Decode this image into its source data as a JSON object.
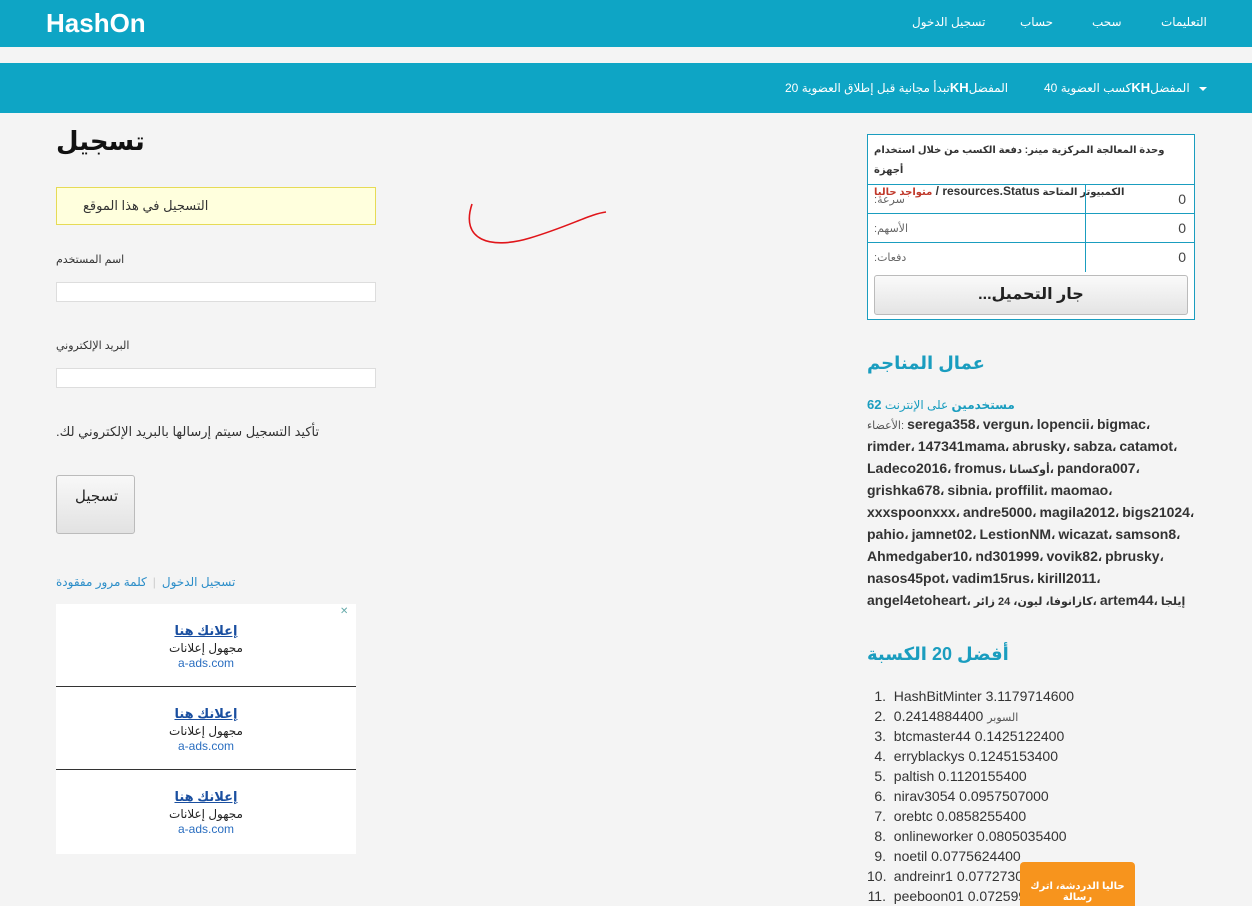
{
  "header": {
    "brand": "HashOn",
    "nav": [
      "التعليمات",
      "سحب",
      "حساب",
      "تسجيل الدخول"
    ]
  },
  "subnav": {
    "item1_prefix": "المفضل ",
    "item1_strong": "KH",
    "item1_suffix": "كسب العضوية 40",
    "item2_prefix": "المفضل ",
    "item2_strong": "KH",
    "item2_suffix": "تبدأ مجانية قبل إطلاق العضوية 20"
  },
  "register": {
    "title": "تسجيل",
    "notice": "التسجيل في هذا الموقع",
    "username_label": "اسم المستخدم",
    "email_label": "البريد الإلكتروني",
    "confirm_text": ".تأكيد التسجيل سيتم إرسالها بالبريد الإلكتروني لك",
    "button_label": "تسجيل",
    "login_link": "تسجيل الدخول",
    "lost_password_link": "كلمة مرور مفقودة"
  },
  "ads": [
    {
      "title": "إعلانك هنا",
      "subtitle": "مجهول إعلانات",
      "url": "a-ads.com"
    },
    {
      "title": "إعلانك هنا",
      "subtitle": "مجهول إعلانات",
      "url": "a-ads.com"
    },
    {
      "title": "إعلانك هنا",
      "subtitle": "مجهول إعلانات",
      "url": "a-ads.com"
    }
  ],
  "miner": {
    "head_line1": "وحدة المعالجة المركزية مينر: دفعة الكسب من خلال استخدام أجهزة",
    "head_line2_a": "الكمبيوتر المتاحة ",
    "head_line2_b": "resources.Status / ",
    "head_line2_status": "متواجد حاليا",
    "rows": [
      {
        "label": ":سرعة",
        "value": "0"
      },
      {
        "label": ":الأسهم",
        "value": "0"
      },
      {
        "label": ":دفعات",
        "value": "0"
      }
    ],
    "button": "...جار التحميل"
  },
  "workers": {
    "title": "عمال المناجم",
    "online_count": "62",
    "online_label": " على الإنترنت",
    "online_users_word": "مستخدمين",
    "members_prefix": "الأعضاء: ",
    "members": [
      "serega358",
      "vergun",
      "lopencii",
      "bigmac",
      "rimder",
      "147341mama",
      "abrusky",
      "sabza",
      "catamot",
      "Ladeco2016",
      "fromus",
      "أوكسانا",
      "pandora007",
      "grishka678",
      "sibnia",
      "proffilit",
      "maomao",
      "xxxspoonxxx",
      "andre5000",
      "magila2012",
      "bigs21024",
      "pahio",
      "jamnet02",
      "LestionNM",
      "wicazat",
      "samson8",
      "Ahmedgaber10",
      "nd301999",
      "vovik82",
      "pbrusky",
      "nasos45pot",
      "vadim15rus",
      "kirill2011",
      "angel4etoheart",
      "كازانوفا",
      "ليون",
      "24 زائر",
      "artem44",
      "إيلجا"
    ]
  },
  "top20": {
    "title": "أفضل 20 الكسبة",
    "items": [
      {
        "rank": "1.",
        "name": "HashBitMinter",
        "value": "3.1179714600"
      },
      {
        "rank": "2.",
        "name": "السوبر",
        "value": "0.2414884400"
      },
      {
        "rank": "3.",
        "name": "btcmaster44",
        "value": "0.1425122400"
      },
      {
        "rank": "4.",
        "name": "erryblackys",
        "value": "0.1245153400"
      },
      {
        "rank": "5.",
        "name": "paltish",
        "value": "0.1120155400"
      },
      {
        "rank": "6.",
        "name": "nirav3054",
        "value": "0.0957507000"
      },
      {
        "rank": "7.",
        "name": "orebtc",
        "value": "0.0858255400"
      },
      {
        "rank": "8.",
        "name": "onlineworker",
        "value": "0.0805035400"
      },
      {
        "rank": "9.",
        "name": "noetil",
        "value": "0.0775624400"
      },
      {
        "rank": "10.",
        "name": "andreinr1",
        "value": "0.0772730"
      },
      {
        "rank": "11.",
        "name": "peeboon01",
        "value": "0.072599"
      }
    ]
  },
  "chat": {
    "label": "حاليا الدردشة، اترك رسالة"
  },
  "colors": {
    "header": "#0ea5c5",
    "accent": "#1a9dbf",
    "chat": "#f7941d",
    "notice_bg": "#ffffdd"
  }
}
